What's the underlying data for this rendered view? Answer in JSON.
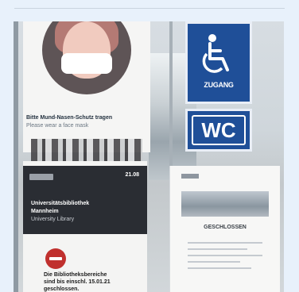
{
  "photo": {
    "mask_poster": {
      "line1": "Bitte Mund-Nasen-Schutz tragen",
      "line2": "Please wear a face mask"
    },
    "access_sign": {
      "label": "ZUGANG"
    },
    "wc_sign": {
      "label": "WC"
    },
    "library_sign": {
      "date": "21.08",
      "name_line1": "Universitätsbibliothek",
      "name_line2": "Mannheim",
      "name_line3": "University Library",
      "closed_line1": "Die Bibliotheksbereiche",
      "closed_line2": "sind bis einschl. 15.01.21",
      "closed_line3": "geschlossen."
    },
    "notice": {
      "title": "GESCHLOSSEN"
    },
    "colors": {
      "sign_blue": "#1f4f98",
      "no_entry_red": "#c0302e",
      "background": "#e8f1fb"
    }
  }
}
